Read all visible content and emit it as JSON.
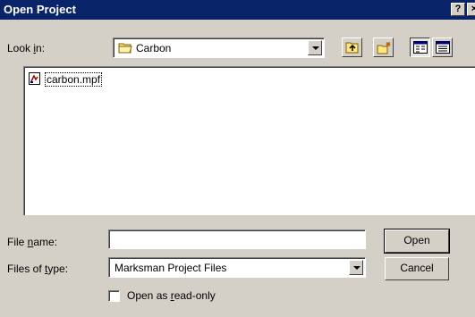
{
  "window": {
    "title": "Open Project",
    "help_label": "?",
    "close_label": "×"
  },
  "look_in": {
    "label_pre": "Look ",
    "label_key": "i",
    "label_post": "n:",
    "value": "Carbon"
  },
  "files": [
    {
      "name": "carbon.mpf"
    }
  ],
  "file_name": {
    "label_pre": "File ",
    "label_key": "n",
    "label_post": "ame:",
    "value": ""
  },
  "file_type": {
    "label_pre": "Files of ",
    "label_key": "t",
    "label_post": "ype:",
    "value": "Marksman Project Files"
  },
  "buttons": {
    "open_key": "O",
    "open_rest": "pen",
    "cancel": "Cancel"
  },
  "read_only": {
    "label_pre": "Open as ",
    "label_key": "r",
    "label_post": "ead-only",
    "checked": false
  },
  "icons": [
    "folder-icon",
    "up-folder-icon",
    "new-folder-icon",
    "list-view-icon",
    "details-view-icon",
    "project-file-icon"
  ]
}
